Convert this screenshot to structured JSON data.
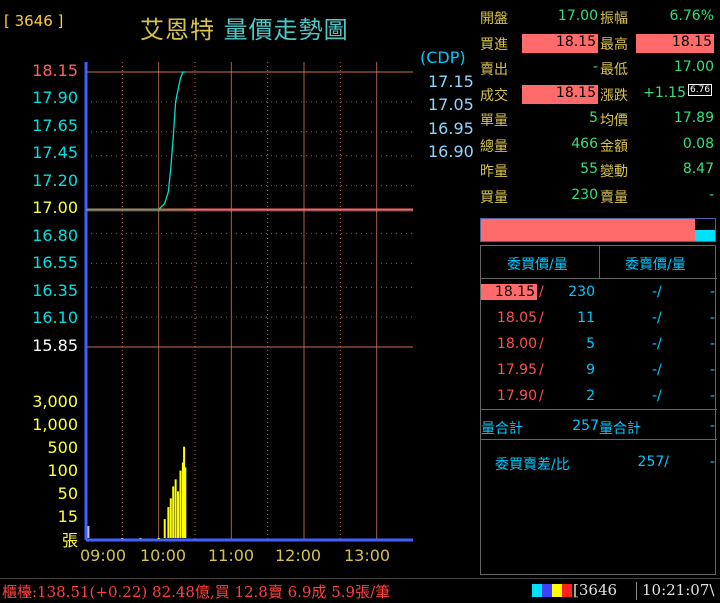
{
  "header": {
    "stock_code": "[ 3646 ]",
    "stock_name": "艾恩特",
    "chart_title": "量價走勢圖"
  },
  "cdp": {
    "label": "(CDP)",
    "values": [
      "17.15",
      "17.05",
      "16.95",
      "16.90"
    ]
  },
  "price_axis": {
    "labels": [
      "18.15",
      "17.90",
      "17.65",
      "17.45",
      "17.20",
      "17.00",
      "16.80",
      "16.55",
      "16.35",
      "16.10",
      "15.85"
    ]
  },
  "volume_axis": {
    "labels": [
      "3,000",
      "1,000",
      "500",
      "100",
      "50",
      "15"
    ],
    "unit": "張"
  },
  "time_axis": {
    "labels": [
      "09:00",
      "10:00",
      "11:00",
      "12:00",
      "13:00"
    ]
  },
  "colors": {
    "price_line": "#00e0d0",
    "avg_line": "#30c030",
    "volume_bar": "#ffff00",
    "ref_line": "#ff6060",
    "axis": "#4060ff",
    "grid": "#c87050",
    "limit_up": "#ff6b6b"
  },
  "chart_data": {
    "type": "line",
    "x_range": [
      "09:00",
      "13:30"
    ],
    "ylim": [
      15.85,
      18.15
    ],
    "reference_price": 17.0,
    "series": [
      {
        "values": [
          [
            "09:00",
            17.0
          ],
          [
            "09:10",
            17.0
          ],
          [
            "09:20",
            17.0
          ],
          [
            "09:30",
            17.0
          ],
          [
            "09:40",
            17.0
          ],
          [
            "09:50",
            17.0
          ],
          [
            "10:00",
            17.0
          ],
          [
            "10:05",
            17.05
          ],
          [
            "10:08",
            17.15
          ],
          [
            "10:10",
            17.35
          ],
          [
            "10:12",
            17.6
          ],
          [
            "10:14",
            17.9
          ],
          [
            "10:16",
            18.0
          ],
          [
            "10:18",
            18.1
          ],
          [
            "10:20",
            18.15
          ],
          [
            "10:22",
            18.15
          ]
        ]
      },
      {
        "values": [
          [
            "09:00",
            17.0
          ],
          [
            "09:30",
            17.0
          ],
          [
            "10:00",
            17.0
          ],
          [
            "10:10",
            17.0
          ],
          [
            "10:20",
            17.0
          ],
          [
            "10:22",
            17.0
          ]
        ]
      }
    ],
    "volume": {
      "x": [
        "09:02",
        "09:30",
        "09:45",
        "10:00",
        "10:05",
        "10:08",
        "10:10",
        "10:12",
        "10:14",
        "10:16",
        "10:18",
        "10:20",
        "10:21",
        "10:22"
      ],
      "values": [
        2,
        1,
        1,
        1,
        3,
        6,
        10,
        20,
        30,
        15,
        50,
        80,
        200,
        60
      ]
    }
  },
  "quote": {
    "rows": [
      {
        "l1": "開盤",
        "v1": "17.00",
        "l2": "振幅",
        "v2": "6.76%",
        "h1": false,
        "h2": false
      },
      {
        "l1": "買進",
        "v1": "18.15",
        "l2": "最高",
        "v2": "18.15",
        "h1": true,
        "h2": true
      },
      {
        "l1": "賣出",
        "v1": "-",
        "l2": "最低",
        "v2": "17.00",
        "h1": false,
        "h2": false
      },
      {
        "l1": "成交",
        "v1": "18.15",
        "l2": "漲跌",
        "v2": "+1.15",
        "h1": true,
        "h2": false
      },
      {
        "l1": "單量",
        "v1": "5",
        "l2": "均價",
        "v2": "17.89",
        "h1": false,
        "h2": false
      },
      {
        "l1": "總量",
        "v1": "466",
        "l2": "金額",
        "v2": "0.08",
        "h1": false,
        "h2": false
      },
      {
        "l1": "昨量",
        "v1": "55",
        "l2": "變動",
        "v2": "8.47",
        "h1": false,
        "h2": false
      },
      {
        "l1": "買量",
        "v1": "230",
        "l2": "賣量",
        "v2": "-",
        "h1": false,
        "h2": false
      }
    ],
    "change_pct": "6.76"
  },
  "orderbook": {
    "bid_header": "委買價/量",
    "ask_header": "委賣價/量",
    "rows": [
      {
        "bid": "18.15",
        "bqty": "230",
        "ask": "-",
        "aqty": "-"
      },
      {
        "bid": "18.05",
        "bqty": "11",
        "ask": "-",
        "aqty": "-"
      },
      {
        "bid": "18.00",
        "bqty": "5",
        "ask": "-",
        "aqty": "-"
      },
      {
        "bid": "17.95",
        "bqty": "9",
        "ask": "-",
        "aqty": "-"
      },
      {
        "bid": "17.90",
        "bqty": "2",
        "ask": "-",
        "aqty": "-"
      }
    ],
    "bid_total_label": "量合計",
    "bid_total": "257",
    "ask_total_label": "量合計",
    "ask_total": "-",
    "diff_label": "委買賣差/比",
    "diff_value": "257/",
    "diff_ratio": "-"
  },
  "status": {
    "text": "櫃檯:138.51(+0.22) 82.48億,買 12.8賣 6.9成 5.9張/筆",
    "code": "[3646",
    "time": "10:21:07\\"
  }
}
